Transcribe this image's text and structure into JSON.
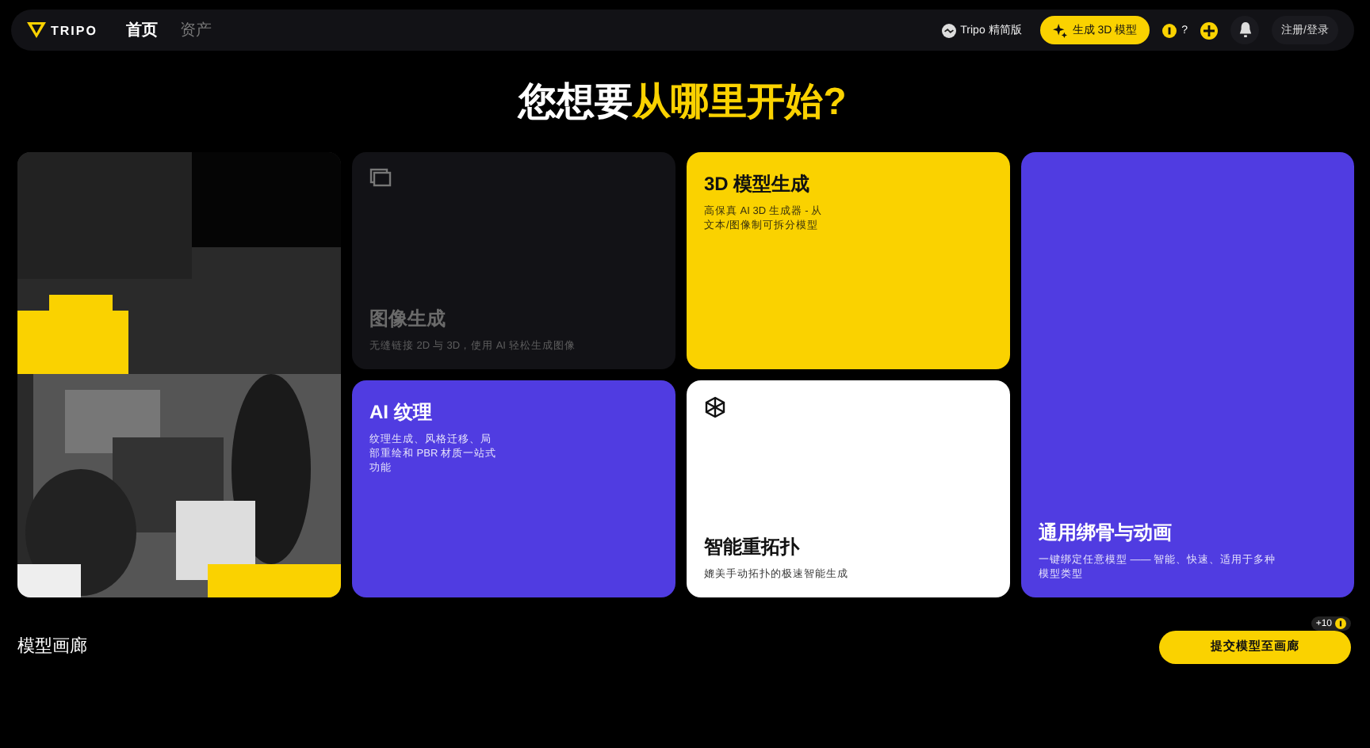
{
  "header": {
    "logo": "TRIPO",
    "nav": [
      {
        "label": "首页",
        "selected": true
      },
      {
        "label": "资产",
        "selected": false
      }
    ],
    "lite_link": "Tripo 精简版",
    "generate_button": "生成 3D 模型",
    "credits": "?",
    "login": "注册/登录"
  },
  "headline": {
    "lead": "您想要",
    "highlight": "从哪里开始?"
  },
  "cards": [
    {
      "title": "图像生成",
      "description": "无缝链接 2D 与 3D，使用 AI 轻松生成图像",
      "color": "#121216",
      "disabled": true
    },
    {
      "title": "3D 模型生成",
      "description": "高保真 AI 3D 生成器 - 从文本/图像制可拆分模型",
      "color": "#fad200",
      "disabled": false
    },
    {
      "title": "通用绑骨与动画",
      "description": "一键绑定任意模型 —— 智能、快速、适用于多种模型类型",
      "color": "#503ce1",
      "disabled": false
    },
    {
      "title": "AI 纹理",
      "description": "纹理生成、风格迁移、局部重绘和 PBR 材质一站式功能",
      "color": "#503ce1",
      "disabled": false
    },
    {
      "title": "智能重拓扑",
      "description": "媲美手动拓扑的极速智能生成",
      "color": "#ffffff",
      "disabled": false
    }
  ],
  "gallery": {
    "title": "模型画廊",
    "submit_button": "提交模型至画廊",
    "reward_badge": "+10"
  }
}
